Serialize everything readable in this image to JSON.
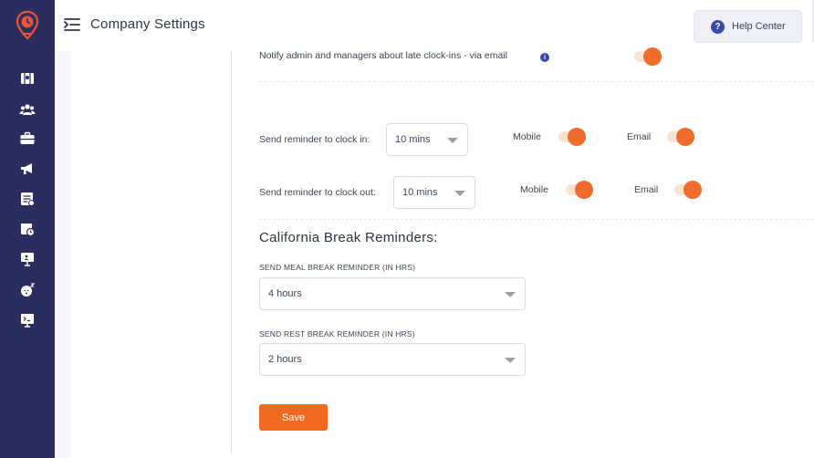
{
  "header": {
    "title": "Company Settings",
    "help_label": "Help Center",
    "help_icon": "?"
  },
  "sidebar": {
    "items": [
      {
        "icon": "map-icon"
      },
      {
        "icon": "people-icon"
      },
      {
        "icon": "briefcase-icon"
      },
      {
        "icon": "megaphone-icon"
      },
      {
        "icon": "report-icon"
      },
      {
        "icon": "calendar-clock-icon"
      },
      {
        "icon": "presentation-icon"
      },
      {
        "icon": "sleep-icon"
      },
      {
        "icon": "terminal-icon"
      }
    ]
  },
  "notify": {
    "label": "Notify admin and managers about late clock-ins - via email",
    "info_icon": "i",
    "enabled": true
  },
  "reminders": {
    "clock_in": {
      "label": "Send reminder to clock in:",
      "value": "10 mins",
      "mobile_label": "Mobile",
      "mobile_enabled": true,
      "email_label": "Email",
      "email_enabled": true
    },
    "clock_out": {
      "label": "Send reminder to clock out:",
      "value": "10 mins",
      "mobile_label": "Mobile",
      "mobile_enabled": true,
      "email_label": "Email",
      "email_enabled": true
    }
  },
  "california": {
    "title": "California Break Reminders:",
    "meal_label": "SEND MEAL BREAK REMINDER (IN HRS)",
    "meal_value": "4 hours",
    "rest_label": "SEND REST BREAK REMINDER (IN HRS)",
    "rest_value": "2 hours"
  },
  "save_label": "Save",
  "colors": {
    "sidebar": "#2b2d5e",
    "accent": "#ef6c2d",
    "toggle_track": "#fbe3d3",
    "help_icon": "#3a49a8"
  }
}
